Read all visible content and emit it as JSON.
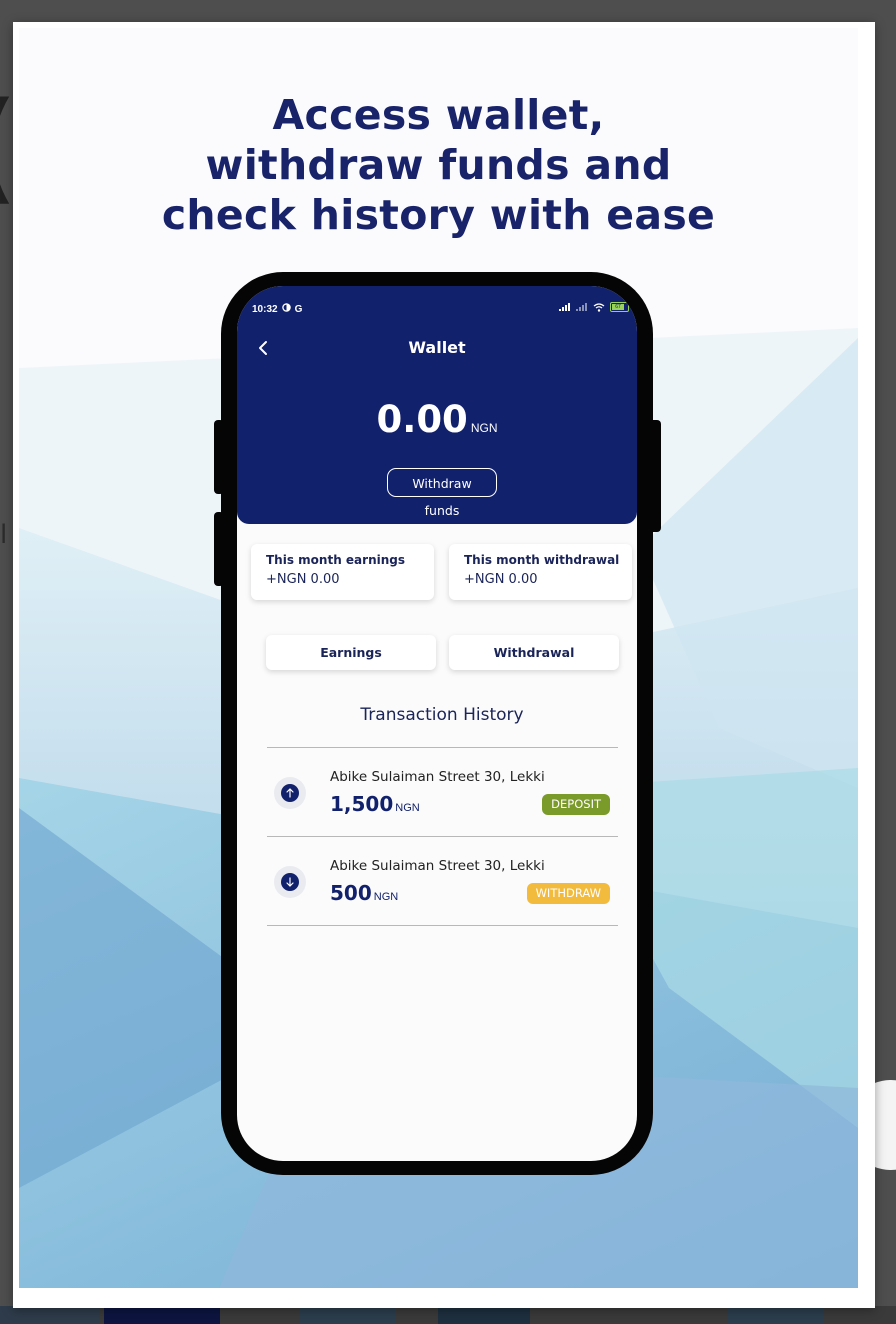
{
  "background_app": {
    "left_glyph": "(",
    "left_fragment": "l"
  },
  "headline": {
    "line1": "Access wallet,",
    "line2": "withdraw funds and",
    "line3": "check history with ease"
  },
  "status_bar": {
    "time": "10:32",
    "g_label": "G",
    "battery_level": "67"
  },
  "wallet": {
    "title": "Wallet",
    "balance": "0.00",
    "currency": "NGN",
    "withdraw_button": "Withdraw funds"
  },
  "stats": [
    {
      "label": "This month earnings",
      "value": "+NGN 0.00"
    },
    {
      "label": "This month withdrawal",
      "value": "+NGN 0.00"
    }
  ],
  "tabs": [
    "Earnings",
    "Withdrawal"
  ],
  "history": {
    "title": "Transaction History",
    "items": [
      {
        "address": "Abike Sulaiman Street 30, Lekki",
        "amount": "1,500",
        "currency": "NGN",
        "type": "DEPOSIT",
        "direction": "up"
      },
      {
        "address": "Abike Sulaiman Street 30, Lekki",
        "amount": "500",
        "currency": "NGN",
        "type": "WITHDRAW",
        "direction": "down"
      }
    ]
  },
  "colors": {
    "brand": "#12216b",
    "deposit": "#7a9a2a",
    "withdraw": "#f2bb3e",
    "headline": "#18236a"
  }
}
